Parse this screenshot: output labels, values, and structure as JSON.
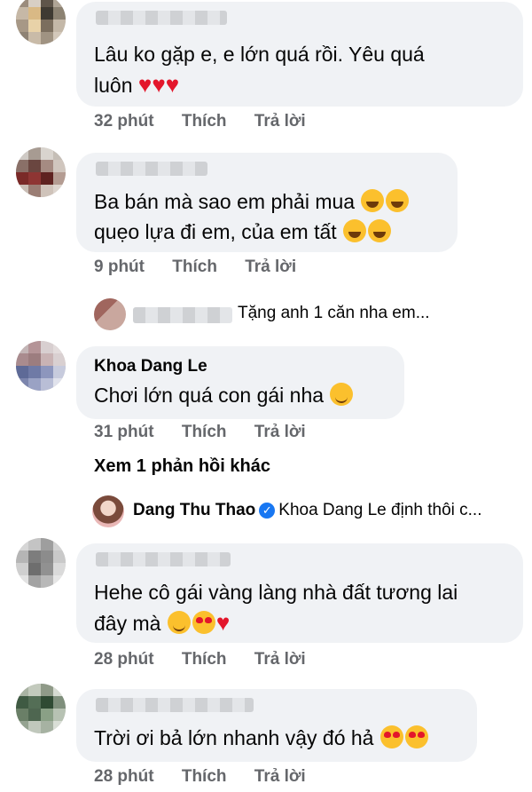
{
  "comments": [
    {
      "text_lines": [
        "Lâu ko gặp e, e lớn quá rồi. Yêu quá",
        "luôn"
      ],
      "time": "32 phút"
    },
    {
      "text_lines": [
        "Ba bán mà sao em phải mua",
        "quẹo lựa đi em, của em tất"
      ],
      "time": "9 phút"
    },
    {
      "author": "Khoa Dang Le",
      "text_lines": [
        "Chơi lớn quá con gái nha"
      ],
      "time": "31 phút"
    },
    {
      "text_lines": [
        "Hehe cô gái vàng làng nhà đất tương lai",
        "đây mà"
      ],
      "time": "28 phút"
    },
    {
      "text_lines": [
        "Trời ơi bả lớn nhanh vậy đó hả"
      ],
      "time": "28 phút"
    }
  ],
  "actions": {
    "like": "Thích",
    "reply": "Trả lời"
  },
  "reply_preview_1": {
    "text": "Tặng anh 1 căn nha em..."
  },
  "view_more": "Xem 1 phản hồi khác",
  "reply_preview_2": {
    "author": "Dang Thu Thao",
    "text": "Khoa Dang Le định thôi c..."
  },
  "icons": [
    "heart-icon",
    "laughing-tears-emoji-icon",
    "grinning-squint-emoji-icon",
    "wink-emoji-icon",
    "kiss-emoji-icon",
    "heart-eyes-emoji-icon",
    "verified-badge-icon"
  ]
}
